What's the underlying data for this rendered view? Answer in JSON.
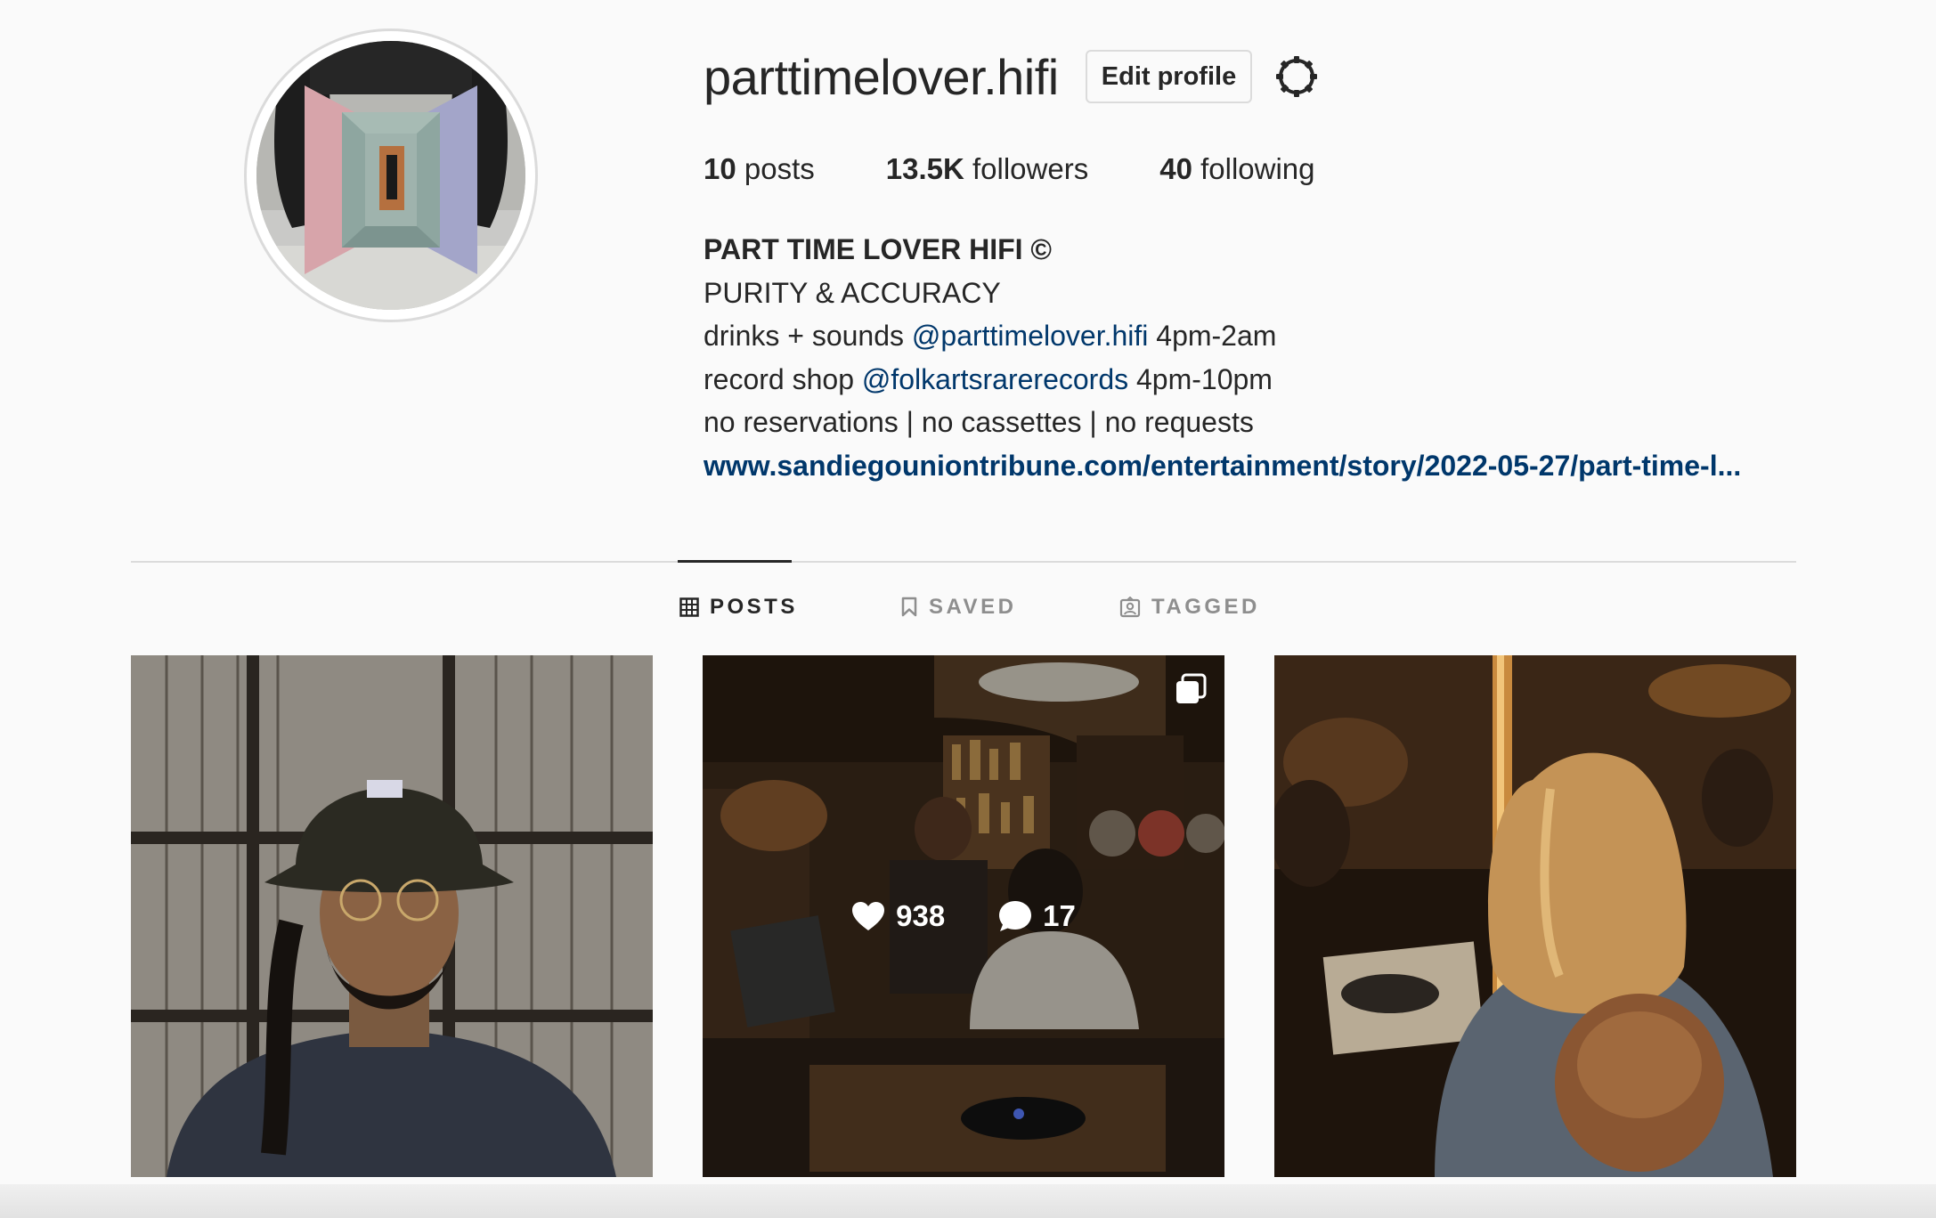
{
  "profile": {
    "username": "parttimelover.hifi",
    "edit_profile_label": "Edit profile",
    "stats": {
      "posts_count": "10",
      "posts_label": " posts",
      "followers_count": "13.5K",
      "followers_label": " followers",
      "following_count": "40",
      "following_label": " following"
    },
    "bio": {
      "name": "PART TIME LOVER HIFI ©",
      "line1": "PURITY & ACCURACY",
      "line2_prefix": "drinks + sounds ",
      "line2_mention": "@parttimelover.hifi",
      "line2_suffix": " 4pm-2am",
      "line3_prefix": "record shop ",
      "line3_mention": "@folkartsrarerecords",
      "line3_suffix": " 4pm-10pm",
      "line4": "no reservations | no cassettes | no requests",
      "link": "www.sandiegouniontribune.com/entertainment/story/2022-05-27/part-time-l..."
    }
  },
  "tabs": [
    {
      "label": "POSTS",
      "icon": "grid-icon",
      "active": true
    },
    {
      "label": "SAVED",
      "icon": "bookmark-icon",
      "active": false
    },
    {
      "label": "TAGGED",
      "icon": "tagged-icon",
      "active": false
    }
  ],
  "posts": [
    {
      "description_icon": "photo",
      "hovered": false
    },
    {
      "description_icon": "carousel-icon",
      "hovered": true,
      "likes": "938",
      "comments": "17"
    },
    {
      "description_icon": "photo",
      "hovered": false
    }
  ],
  "colors": {
    "text": "#262626",
    "secondary": "#8e8e8e",
    "link": "#00376b",
    "border": "#dbdbdb",
    "background": "#fafafa"
  }
}
